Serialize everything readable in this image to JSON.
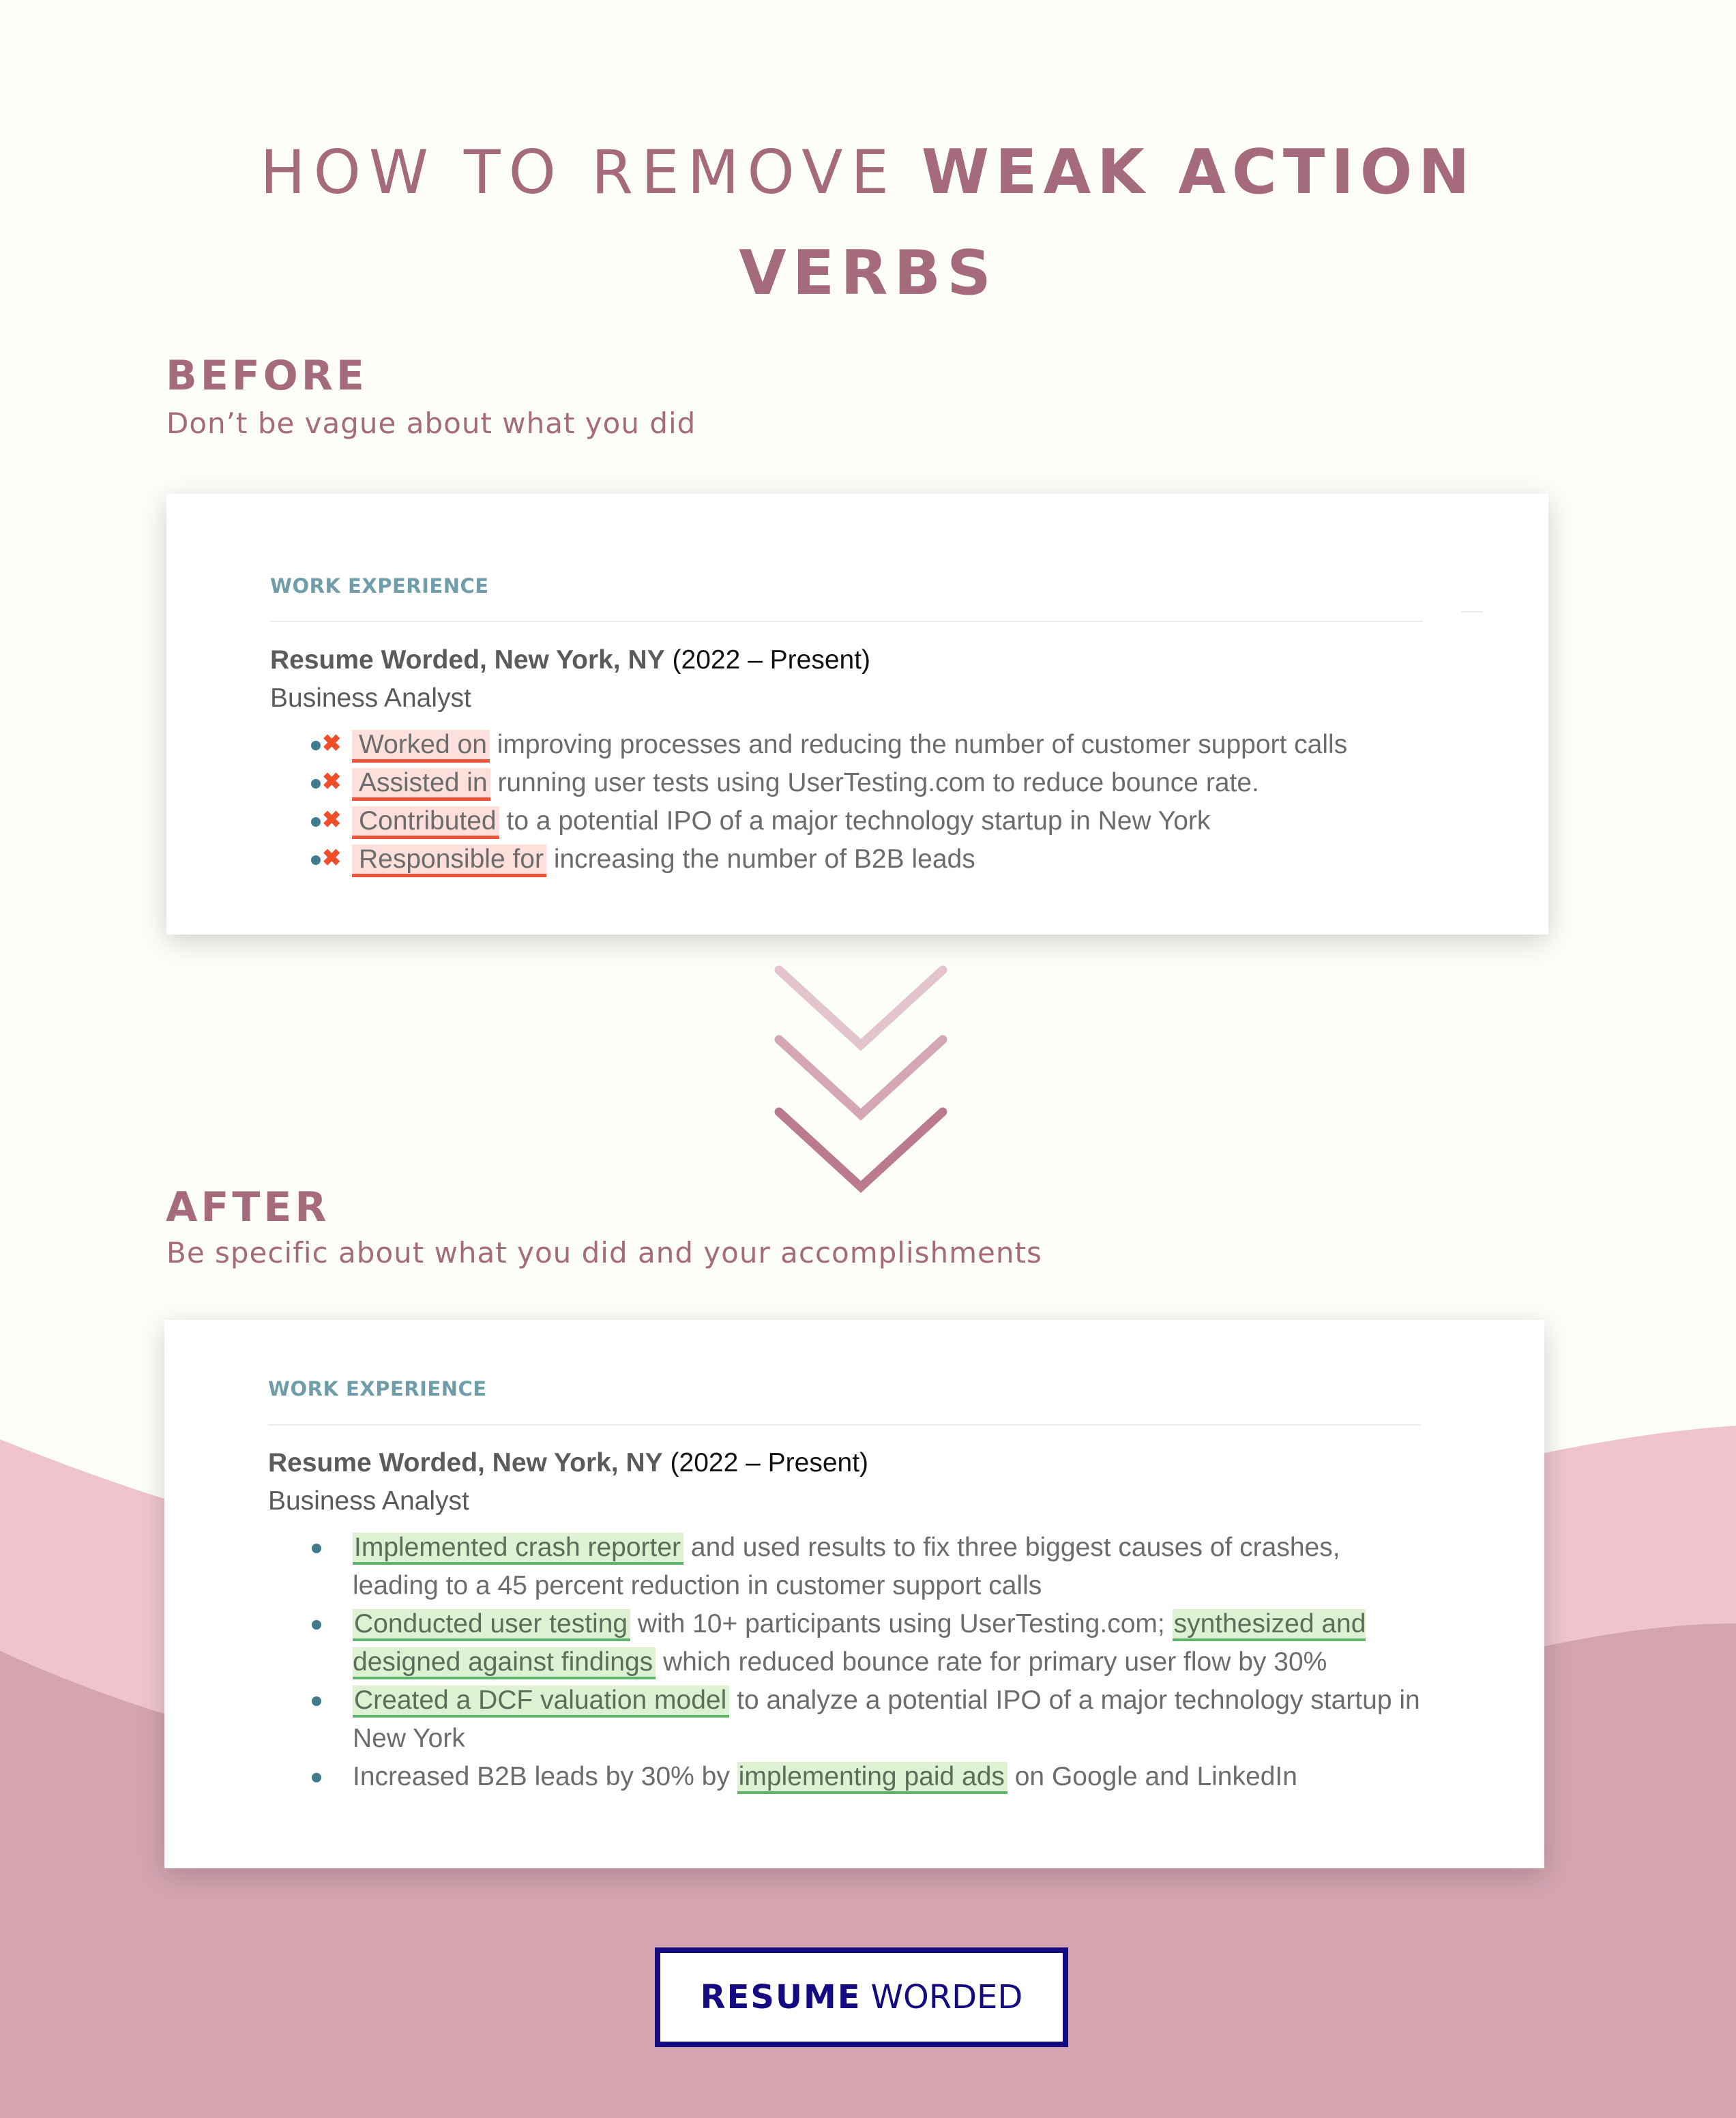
{
  "colors": {
    "accent": "#a56a7c",
    "page_bg": "#fdfdf9",
    "wave_light": "#efc4cf",
    "wave_dark": "#d4a4b1",
    "section_header": "#6f9eaa",
    "bullet_dot": "#3f7a8d",
    "weak_highlight": "#fde0dc",
    "weak_underline": "#ee5536",
    "strong_highlight": "#ddf2d2",
    "strong_underline": "#5fb36b",
    "logo": "#140a82"
  },
  "title": {
    "light": "HOW TO REMOVE",
    "bold_line1": "WEAK ACTION",
    "bold_line2": "VERBS"
  },
  "before": {
    "label": "BEFORE",
    "subtitle": "Don’t be vague  about what you did",
    "card": {
      "section_header": "WORK EXPERIENCE",
      "company": "Resume Worded, New York, NY",
      "dates": "(2022 – Present)",
      "role": "Business Analyst",
      "bullets": [
        {
          "weak_verb": "Worked on",
          "rest": "improving processes and reducing the number of customer support calls",
          "icon": "x-mark-icon"
        },
        {
          "weak_verb": "Assisted in",
          "rest": "running user tests using UserTesting.com to reduce bounce rate.",
          "icon": "x-mark-icon"
        },
        {
          "weak_verb": "Contributed",
          "rest": "to a potential IPO of a major technology startup in New York",
          "icon": "x-mark-icon"
        },
        {
          "weak_verb": "Responsible for",
          "rest": "increasing the number of B2B leads",
          "icon": "x-mark-icon"
        }
      ]
    }
  },
  "arrows": {
    "icon": "triple-chevron-down-icon"
  },
  "after": {
    "label": "AFTER",
    "subtitle": "Be specific about what you did and your accomplishments",
    "card": {
      "section_header": "WORK EXPERIENCE",
      "company": "Resume Worded, New York, NY",
      "dates": "(2022 – Present)",
      "role": "Business Analyst",
      "bullets": [
        {
          "parts": [
            {
              "text": "Implemented crash reporter",
              "highlight": true
            },
            {
              "text": " and used results to fix three biggest causes of crashes, leading to a 45 percent reduction in customer support calls",
              "highlight": false
            }
          ]
        },
        {
          "parts": [
            {
              "text": "Conducted user testing",
              "highlight": true
            },
            {
              "text": " with 10+ participants using UserTesting.com; ",
              "highlight": false
            },
            {
              "text": "synthesized and designed against findings",
              "highlight": true
            },
            {
              "text": " which reduced bounce rate for primary user flow by 30%",
              "highlight": false
            }
          ]
        },
        {
          "parts": [
            {
              "text": "Created a DCF valuation model",
              "highlight": true
            },
            {
              "text": " to analyze a potential IPO of a major technology startup in New York",
              "highlight": false
            }
          ]
        },
        {
          "parts": [
            {
              "text": "Increased B2B leads by 30% by ",
              "highlight": false
            },
            {
              "text": "implementing paid ads",
              "highlight": true
            },
            {
              "text": " on Google and LinkedIn",
              "highlight": false
            }
          ]
        }
      ]
    }
  },
  "logo": {
    "bold": "RESUME",
    "light": "WORDED"
  }
}
